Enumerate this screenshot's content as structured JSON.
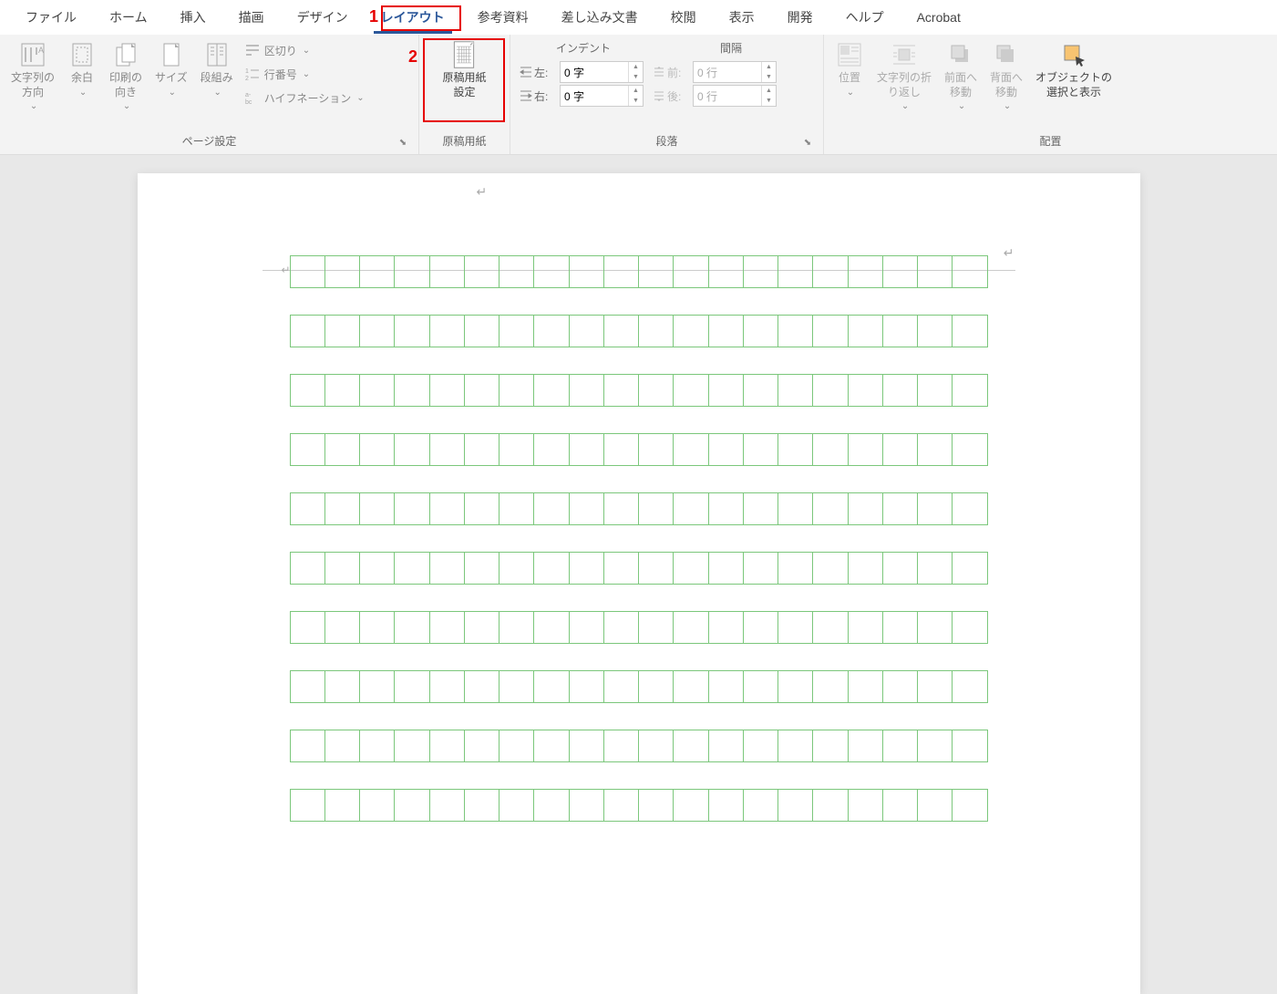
{
  "tabs": {
    "file": "ファイル",
    "home": "ホーム",
    "insert": "挿入",
    "draw": "描画",
    "design": "デザイン",
    "layout": "レイアウト",
    "references": "参考資料",
    "mailings": "差し込み文書",
    "review": "校閲",
    "view": "表示",
    "developer": "開発",
    "help": "ヘルプ",
    "acrobat": "Acrobat"
  },
  "page_setup": {
    "text_direction": "文字列の\n方向",
    "margins": "余白",
    "orientation": "印刷の\n向き",
    "size": "サイズ",
    "columns": "段組み",
    "breaks": "区切り",
    "line_numbers": "行番号",
    "hyphenation": "ハイフネーション",
    "label": "ページ設定"
  },
  "manuscript": {
    "settings": "原稿用紙\n設定",
    "label": "原稿用紙"
  },
  "paragraph": {
    "indent_label": "インデント",
    "spacing_label": "間隔",
    "left_label": "左:",
    "right_label": "右:",
    "before_label": "前:",
    "after_label": "後:",
    "left_value": "0 字",
    "right_value": "0 字",
    "before_value": "0 行",
    "after_value": "0 行",
    "label": "段落"
  },
  "arrange": {
    "position": "位置",
    "wrap_text": "文字列の折\nり返し",
    "bring_forward": "前面へ\n移動",
    "send_backward": "背面へ\n移動",
    "selection_pane": "オブジェクトの\n選択と表示",
    "label": "配置"
  },
  "annotations": {
    "n1": "1",
    "n2": "2"
  },
  "genkou": {
    "columns": 20,
    "rows": 10
  }
}
